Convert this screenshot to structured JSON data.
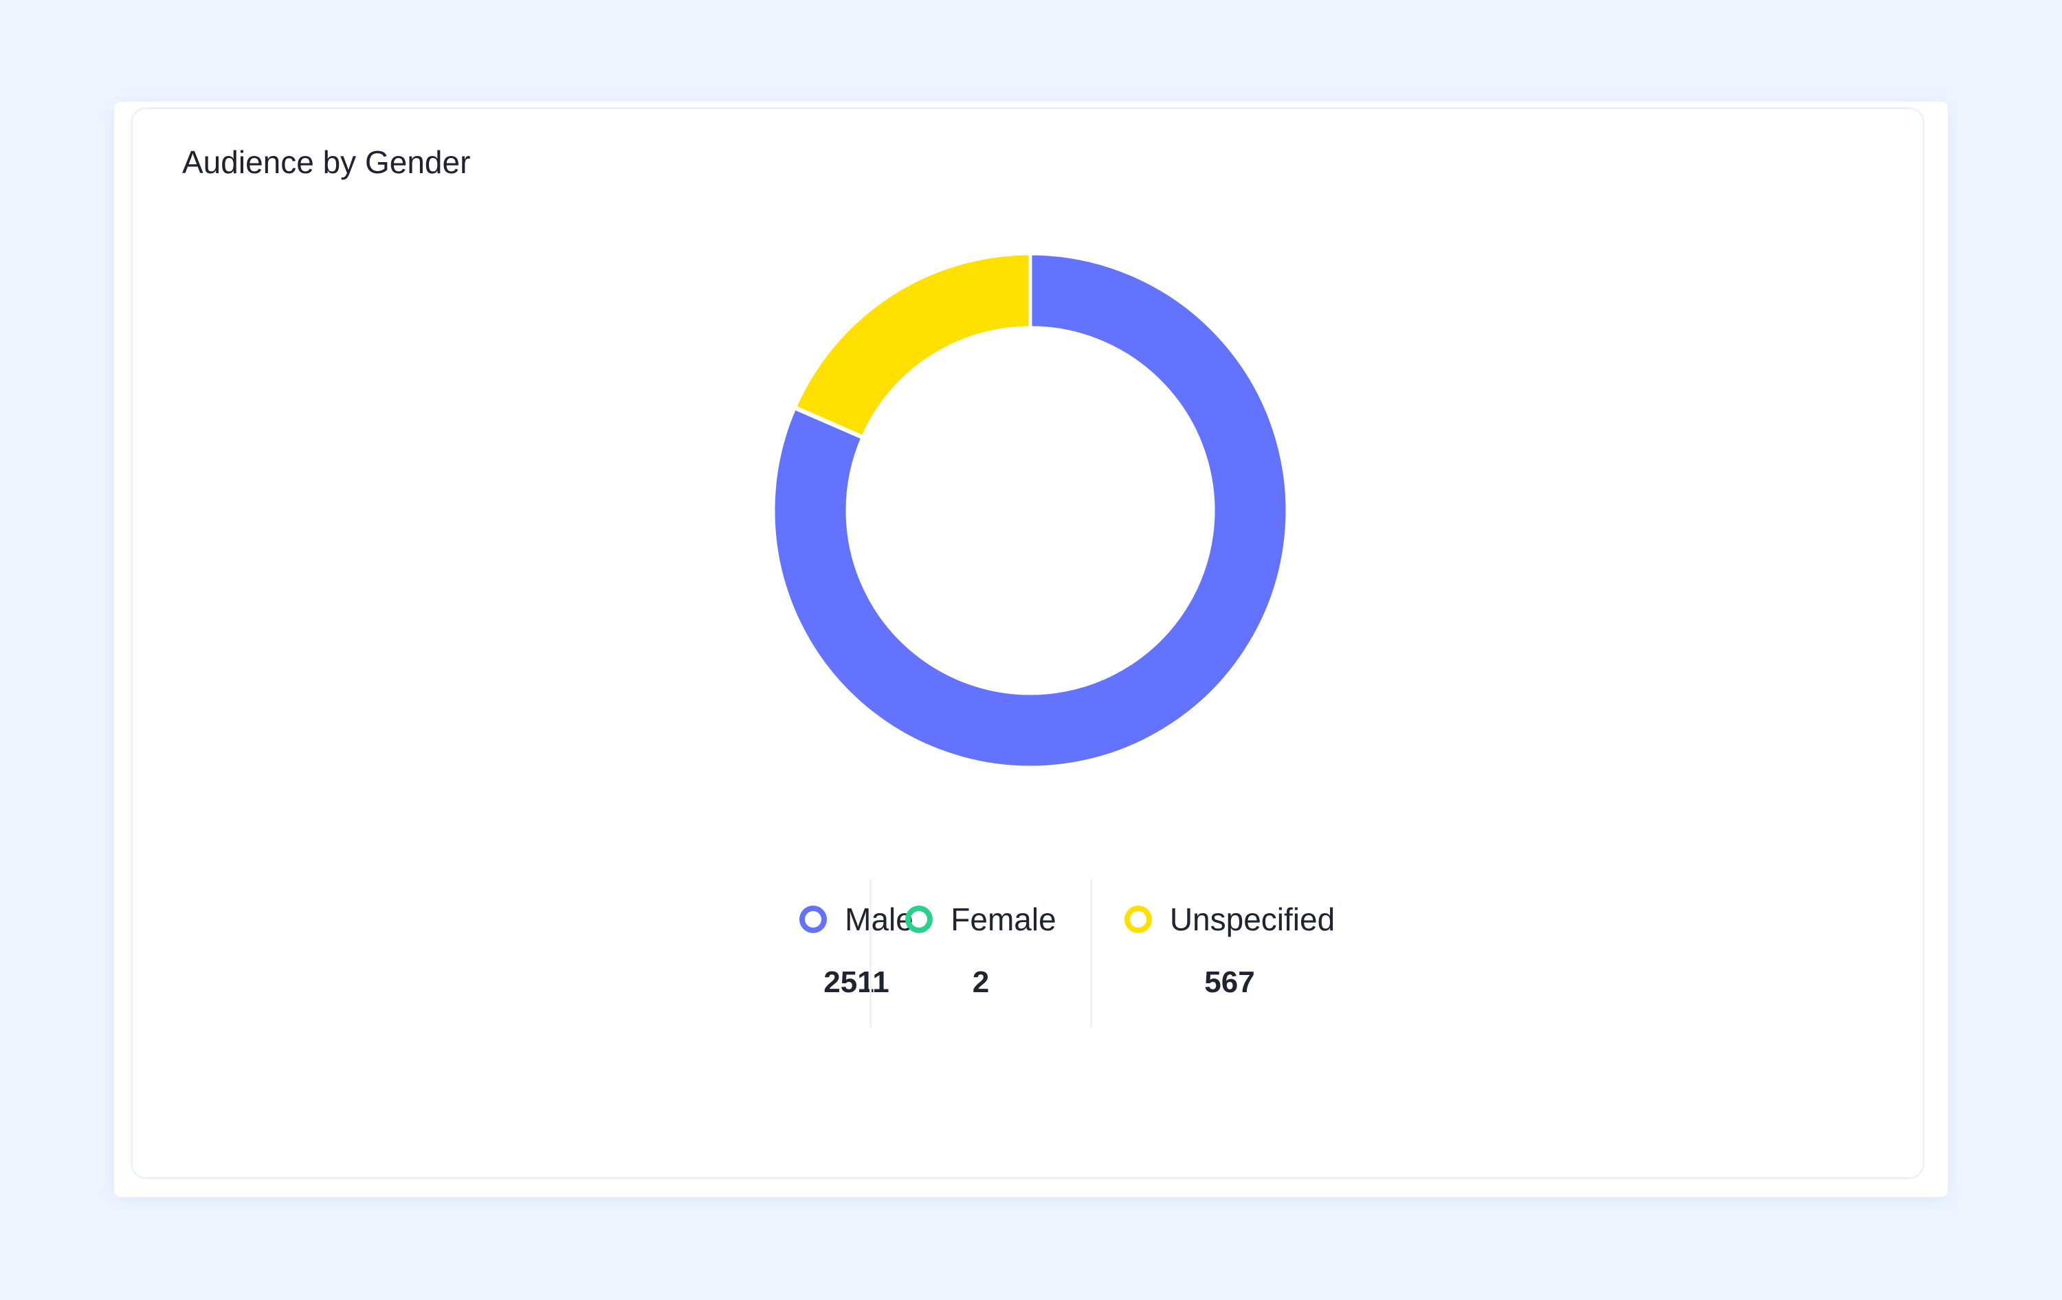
{
  "card": {
    "title": "Audience by Gender"
  },
  "chart_data": {
    "type": "pie",
    "variant": "donut",
    "title": "Audience by Gender",
    "categories": [
      "Male",
      "Female",
      "Unspecified"
    ],
    "values": [
      2511,
      2,
      567
    ],
    "colors": [
      "#6373fe",
      "#2bd08f",
      "#ffe000"
    ],
    "legend": "bottom",
    "legend_items": [
      {
        "label": "Male",
        "value": "2511"
      },
      {
        "label": "Female",
        "value": "2"
      },
      {
        "label": "Unspecified",
        "value": "567"
      }
    ]
  }
}
